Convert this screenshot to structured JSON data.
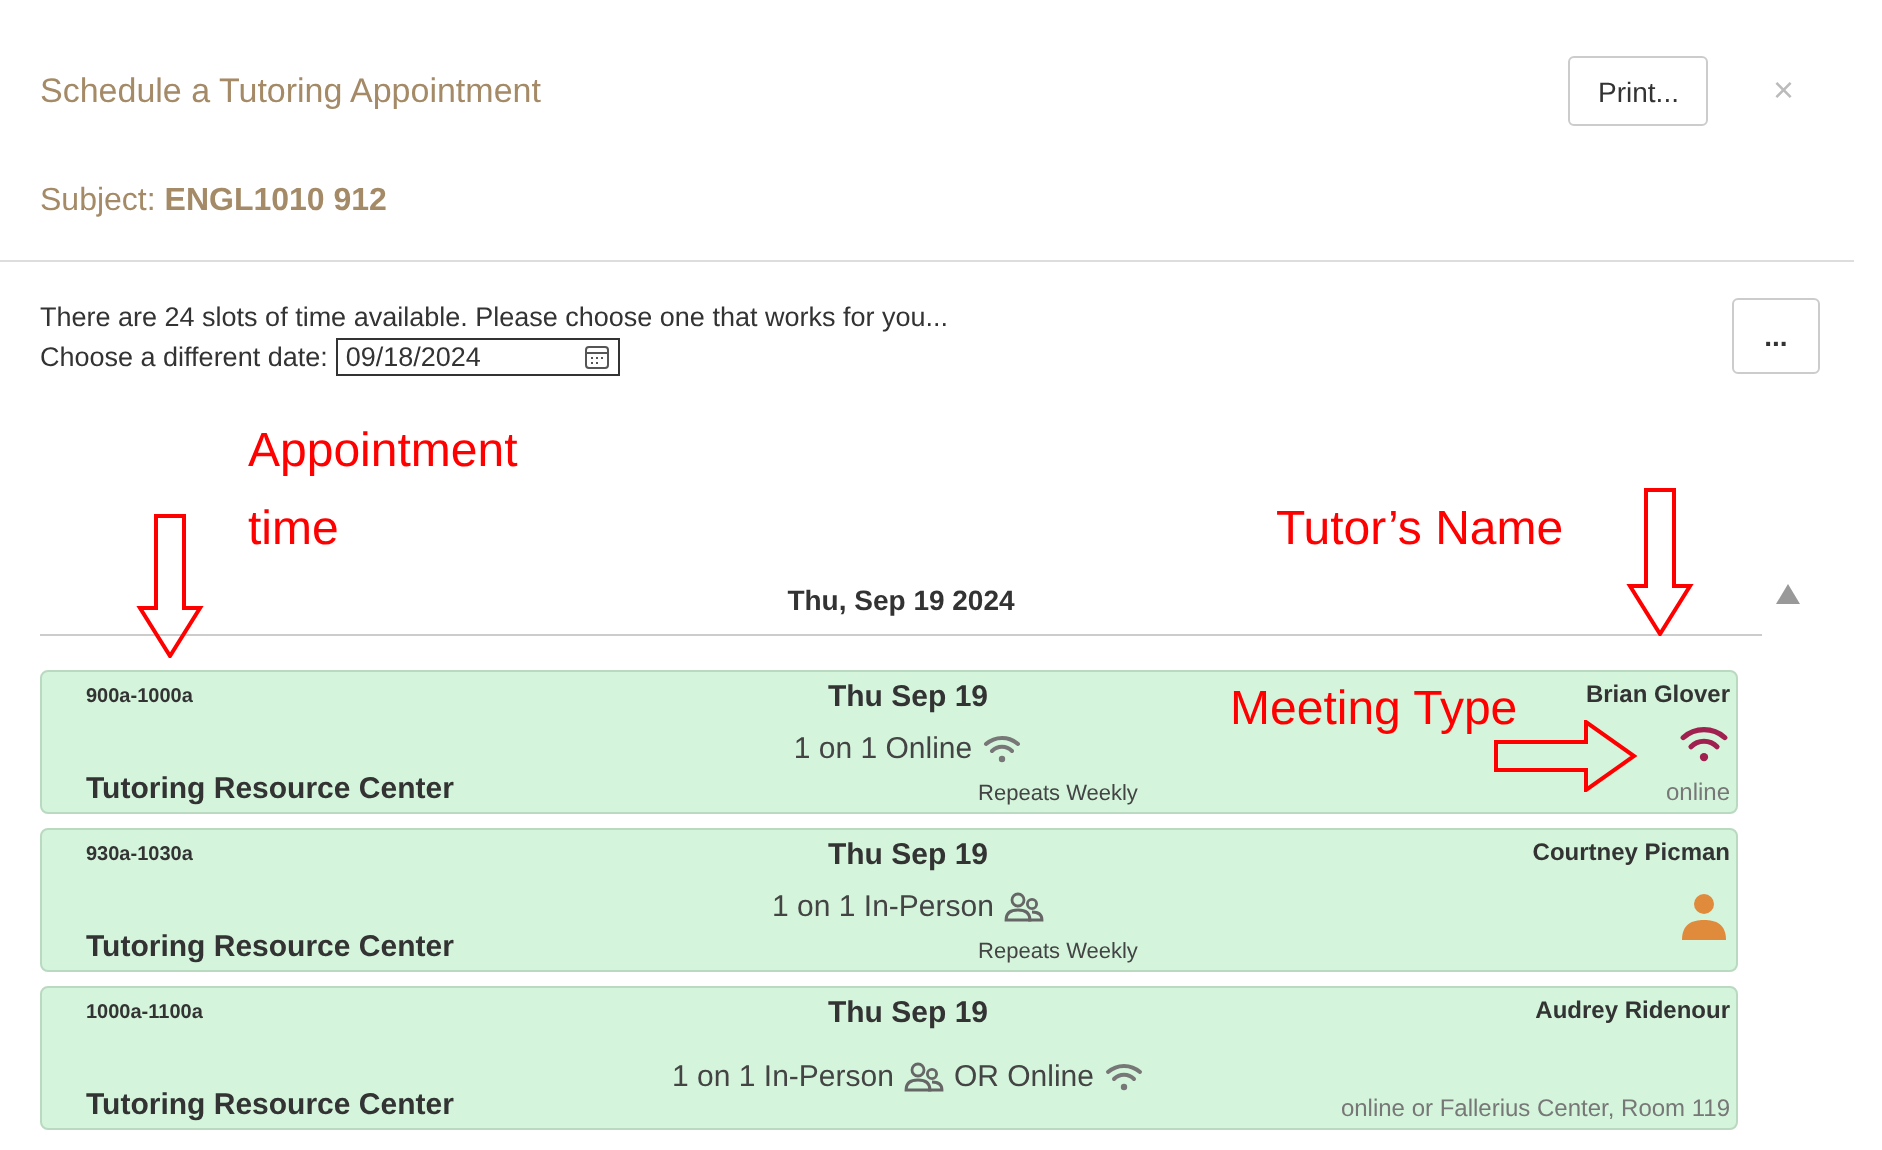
{
  "dialog": {
    "title": "Schedule a Tutoring Appointment",
    "print_button": "Print...",
    "close": "×",
    "subject_label": "Subject:",
    "subject": "ENGL1010 912"
  },
  "info": {
    "message": "There are 24 slots of time available. Please choose one that works for you...",
    "date_label": "Choose a different date:",
    "date_value": "09/18/2024",
    "more_button": "..."
  },
  "day_header": "Thu, Sep 19 2024",
  "slots": [
    {
      "time": "900a-1000a",
      "location": "Tutoring Resource Center",
      "date": "Thu Sep 19",
      "modes": [
        {
          "text": "1 on 1 Online",
          "kind": "wifi"
        }
      ],
      "note": "Repeats Weekly",
      "tutor": "Brian Glover",
      "kind": "online",
      "detail": "online"
    },
    {
      "time": "930a-1030a",
      "location": "Tutoring Resource Center",
      "date": "Thu Sep 19",
      "modes": [
        {
          "text": "1 on 1 In-Person",
          "kind": "people"
        }
      ],
      "note": "Repeats Weekly",
      "tutor": "Courtney Picman",
      "kind": "in-person"
    },
    {
      "time": "1000a-1100a",
      "location": "Tutoring Resource Center",
      "date": "Thu Sep 19",
      "modes": [
        {
          "text": "1 on 1 In-Person",
          "kind": "people"
        },
        {
          "text": "OR Online",
          "kind": "wifi"
        }
      ],
      "tutor": "Audrey Ridenour",
      "kind": "mixed",
      "detail": "online or Fallerius Center, Room 119"
    }
  ],
  "annotations": [
    {
      "text": "Appointment time",
      "kind": "time"
    },
    {
      "text": "Tutor’s Name",
      "kind": "tutor"
    },
    {
      "text": "Meeting Type",
      "kind": "meeting"
    }
  ]
}
